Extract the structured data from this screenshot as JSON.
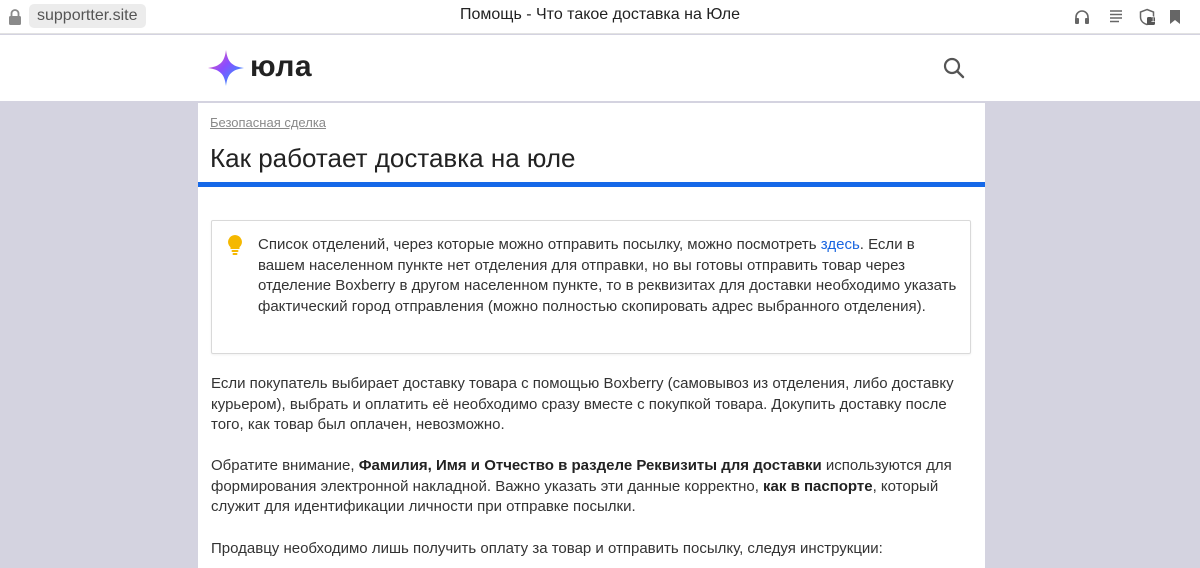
{
  "browser": {
    "url": "supportter.site",
    "tab_title": "Помощь - Что такое доставка на Юле",
    "icons": [
      "lock-icon",
      "headphones-icon",
      "reader-mode-icon",
      "shield-icon",
      "bookmark-icon"
    ],
    "shield_badge": "1"
  },
  "header": {
    "logo_text": "юла",
    "logo_colors": [
      "#ff5fa2",
      "#8a4dff",
      "#3d8bff",
      "#23d1d1"
    ],
    "search_icon": "search-icon"
  },
  "article": {
    "breadcrumb": "Безопасная сделка",
    "title": "Как работает доставка на юле",
    "accent_color": "#1568e8",
    "tip": {
      "icon": "lightbulb-icon",
      "text_before_link": "Список отделений, через которые можно отправить посылку, можно посмотреть ",
      "link_text": "здесь",
      "text_after_link": ".  Если в вашем населенном пункте нет отделения для отправки, но вы готовы отправить товар через отделение Boxberry в другом населенном пункте, то в реквизитах для доставки необходимо указать фактический город отправления (можно полностью скопировать адрес выбранного отделения)."
    },
    "paragraph1": "Если покупатель выбирает доставку товара с помощью Boxberry (самовывоз из отделения, либо доставку курьером), выбрать и оплатить её необходимо сразу вместе с покупкой товара. Докупить доставку после того, как товар был оплачен, невозможно.",
    "paragraph2": {
      "part1": "Обратите внимание, ",
      "bold1": "Фамилия, Имя и Отчество в разделе Реквизиты для доставки",
      "part2": " используются для формирования электронной накладной. Важно указать эти данные корректно, ",
      "bold2": "как в паспорте",
      "part3": ", который служит для идентификации личности при отправке посылки."
    },
    "paragraph3": "Продавцу необходимо лишь получить оплату за товар и отправить посылку, следуя инструкции:"
  }
}
